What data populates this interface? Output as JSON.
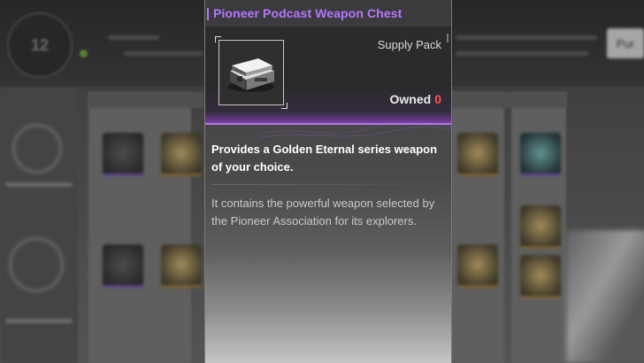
{
  "item": {
    "name": "Pioneer Podcast Weapon Chest",
    "type": "Supply Pack",
    "owned_label": "Owned",
    "owned_count": "0",
    "description": "Provides a Golden Eternal series weapon of your choice.",
    "lore": "It contains the powerful weapon selected by the Pioneer Association for its explorers."
  },
  "background": {
    "level": "12",
    "right_button": "Pur"
  },
  "colors": {
    "title": "#b476ff",
    "owned_count": "#ff5050",
    "accent_line": "#b07ae0"
  },
  "icons": [
    "chest-icon"
  ]
}
